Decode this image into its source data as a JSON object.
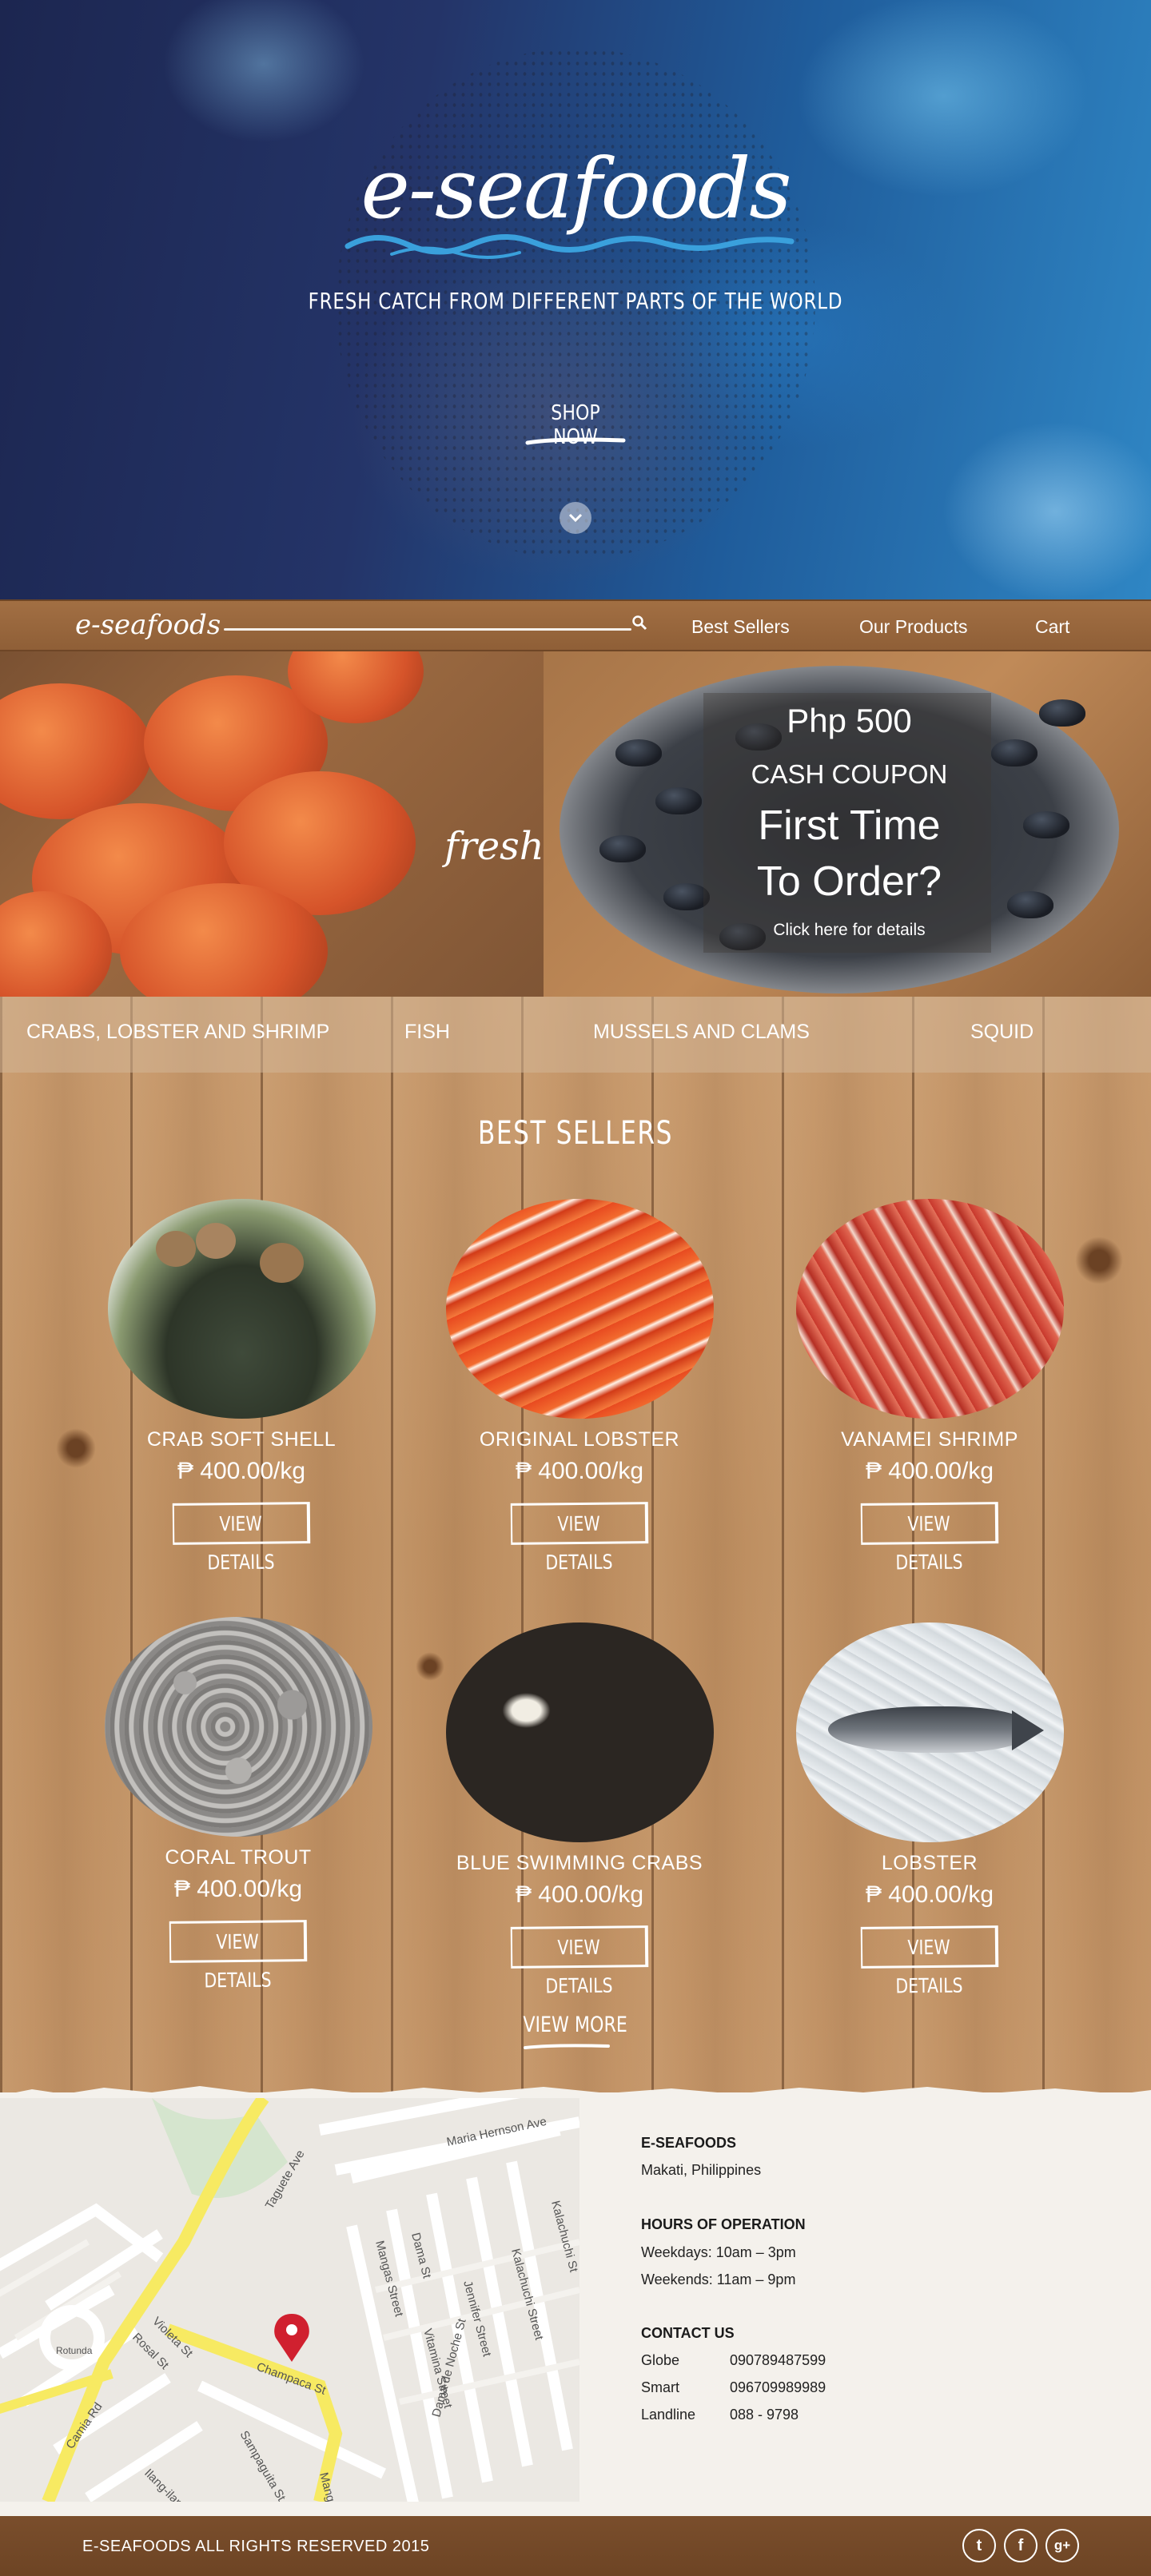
{
  "hero": {
    "logo": "e-seafoods",
    "tagline": "FRESH CATCH FROM DIFFERENT PARTS OF THE WORLD",
    "cta": "SHOP NOW",
    "scroll_icon": "chevron-down-icon"
  },
  "nav": {
    "logo": "e-seafoods",
    "search_icon": "search-icon",
    "links": [
      "Best Sellers",
      "Our Products",
      "Cart"
    ]
  },
  "promo": {
    "left_label": "fresh",
    "coupon_amount": "Php 500",
    "coupon_label": "CASH COUPON",
    "headline_line1": "First Time",
    "headline_line2": "To Order?",
    "details_link": "Click here for details"
  },
  "categories": [
    "CRABS, LOBSTER AND SHRIMP",
    "FISH",
    "MUSSELS AND CLAMS",
    "SQUID"
  ],
  "best_sellers": {
    "title": "BEST SELLERS",
    "button_label": "VIEW DETAILS",
    "products": [
      {
        "name": "CRAB SOFT SHELL",
        "price": "₱ 400.00/kg"
      },
      {
        "name": "ORIGINAL LOBSTER",
        "price": "₱ 400.00/kg"
      },
      {
        "name": "VANAMEI SHRIMP",
        "price": "₱ 400.00/kg"
      },
      {
        "name": "CORAL TROUT",
        "price": "₱ 400.00/kg"
      },
      {
        "name": "BLUE SWIMMING CRABS",
        "price": "₱ 400.00/kg"
      },
      {
        "name": "LOBSTER",
        "price": "₱ 400.00/kg"
      }
    ],
    "view_more": "VIEW MORE"
  },
  "map": {
    "streets": [
      "Taguete Ave",
      "Champaca St",
      "Violeta St",
      "Rosal St",
      "Camia Rd",
      "Ilang-ilang",
      "Sampaguita St",
      "Mangas St",
      "Mangas Street",
      "Dama St",
      "Jennifer Street",
      "Kalachuchi Street",
      "Vitamina Street",
      "Kalachuchi St",
      "Dama de Noche St",
      "Maria Hernson Ave",
      "Rotunda"
    ]
  },
  "contact": {
    "company": "E-SEAFOODS",
    "location": "Makati, Philippines",
    "hours_title": "HOURS OF OPERATION",
    "hours": [
      "Weekdays: 10am – 3pm",
      "Weekends: 11am – 9pm"
    ],
    "contact_title": "CONTACT US",
    "phones": [
      {
        "label": "Globe",
        "number": "090789487599"
      },
      {
        "label": "Smart",
        "number": "096709989989"
      },
      {
        "label": "Landline",
        "number": "088 - 9798"
      }
    ]
  },
  "footer": {
    "copyright": "E-SEAFOODS ALL RIGHTS RESERVED 2015",
    "social": [
      {
        "icon": "twitter-icon",
        "glyph": "t"
      },
      {
        "icon": "facebook-icon",
        "glyph": "f"
      },
      {
        "icon": "google-plus-icon",
        "glyph": "g+"
      }
    ]
  },
  "colors": {
    "wood": "#c49466",
    "nav_wood": "#9a6a3f",
    "footer_wood": "#744a28",
    "paper": "#f4f1ec",
    "map_road": "#f7ea62",
    "map_pin": "#d0202f"
  }
}
